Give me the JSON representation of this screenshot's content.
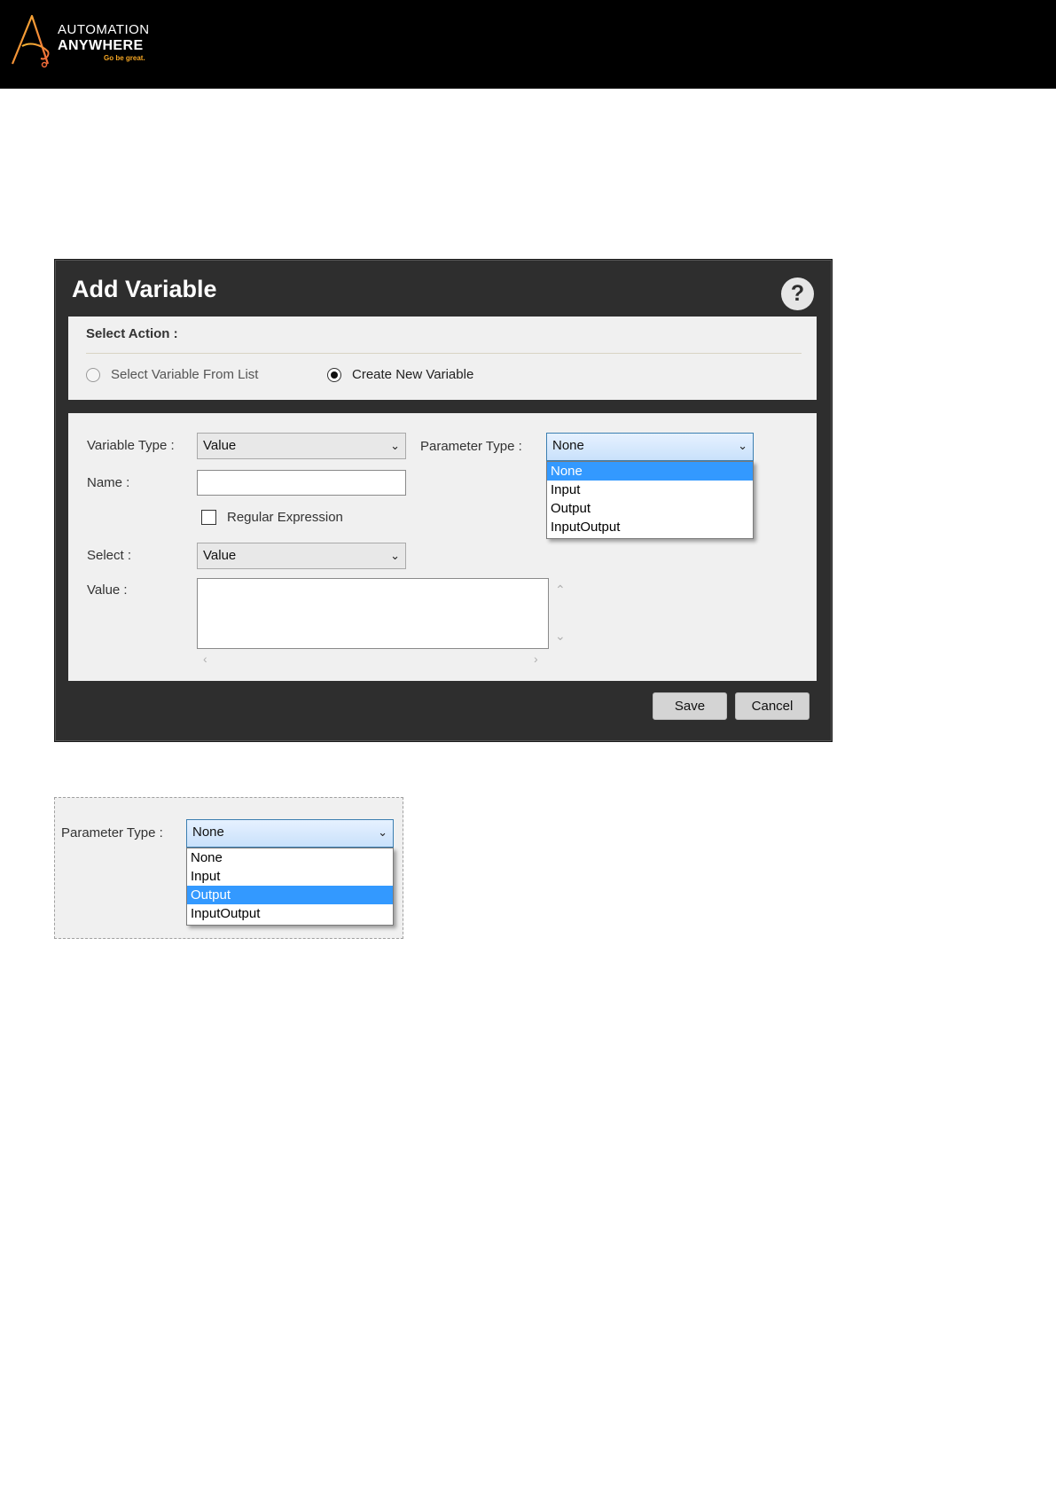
{
  "brand": {
    "line1": "AUTOMATION",
    "line2": "ANYWHERE",
    "tagline": "Go be great."
  },
  "dialog": {
    "title": "Add Variable",
    "help": "?",
    "select_action": {
      "label": "Select Action :",
      "options": [
        {
          "label": "Select Variable From List",
          "checked": false,
          "enabled": false
        },
        {
          "label": "Create New Variable",
          "checked": true,
          "enabled": true
        }
      ]
    },
    "form": {
      "variable_type": {
        "label": "Variable Type :",
        "value": "Value"
      },
      "parameter_type": {
        "label": "Parameter Type :",
        "value": "None",
        "options": [
          "None",
          "Input",
          "Output",
          "InputOutput"
        ],
        "highlighted": "None"
      },
      "name": {
        "label": "Name :",
        "value": ""
      },
      "regular_expression": {
        "label": "Regular Expression",
        "checked": false
      },
      "select": {
        "label": "Select :",
        "value": "Value"
      },
      "value": {
        "label": "Value :",
        "text": ""
      }
    },
    "buttons": {
      "save": "Save",
      "cancel": "Cancel"
    }
  },
  "inset": {
    "parameter_type": {
      "label": "Parameter Type :",
      "value": "None",
      "options": [
        "None",
        "Input",
        "Output",
        "InputOutput"
      ],
      "highlighted": "Output"
    }
  },
  "icons": [
    "automation-anywhere-logo",
    "help-icon",
    "chevron-down-icon",
    "scroll-up-icon",
    "scroll-down-icon",
    "scroll-left-icon",
    "scroll-right-icon"
  ],
  "colors": {
    "dialog_bg": "#2e2e2e",
    "panel_bg": "#f0f0f0",
    "selection_blue": "#3399ff",
    "brand_orange": "#f5a623"
  }
}
